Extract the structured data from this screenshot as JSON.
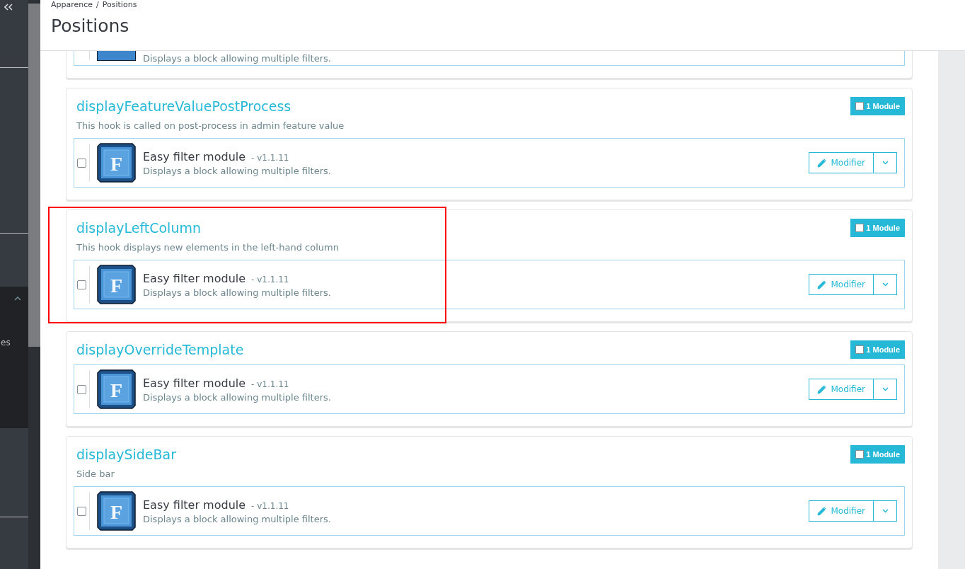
{
  "sidebar": {
    "section_label": "es",
    "section_expanded": true
  },
  "breadcrumb": {
    "items": [
      "Apparence",
      "Positions"
    ],
    "separator": "/"
  },
  "page_title": "Positions",
  "clipped_hook": {
    "modules": [
      {
        "description": "Displays a block allowing multiple filters."
      }
    ]
  },
  "hooks": [
    {
      "name": "displayFeatureValuePostProcess",
      "description": "This hook is called on post-process in admin feature value",
      "module_count": "1 Module",
      "highlighted": false,
      "modules": [
        {
          "logo_text": "F",
          "name": "Easy filter module",
          "version": "- v1.1.11",
          "description": "Displays a block allowing multiple filters.",
          "checked": false,
          "action": "Modifier"
        }
      ]
    },
    {
      "name": "displayLeftColumn",
      "description": "This hook displays new elements in the left-hand column",
      "module_count": "1 Module",
      "highlighted": true,
      "modules": [
        {
          "logo_text": "F",
          "name": "Easy filter module",
          "version": "- v1.1.11",
          "description": "Displays a block allowing multiple filters.",
          "checked": false,
          "action": "Modifier"
        }
      ]
    },
    {
      "name": "displayOverrideTemplate",
      "module_count": "1 Module",
      "highlighted": false,
      "modules": [
        {
          "logo_text": "F",
          "name": "Easy filter module",
          "version": "- v1.1.11",
          "description": "Displays a block allowing multiple filters.",
          "checked": false,
          "action": "Modifier"
        }
      ]
    },
    {
      "name": "displaySideBar",
      "description": "Side bar",
      "module_count": "1 Module",
      "highlighted": false,
      "modules": [
        {
          "logo_text": "F",
          "name": "Easy filter module",
          "version": "- v1.1.11",
          "description": "Displays a block allowing multiple filters.",
          "checked": false,
          "action": "Modifier"
        }
      ]
    }
  ]
}
